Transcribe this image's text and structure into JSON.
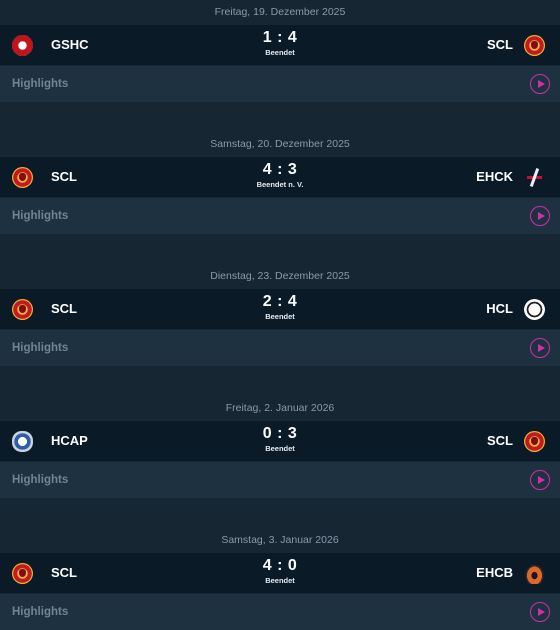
{
  "highlights_label": "Highlights",
  "colors": {
    "background": "#162633",
    "match_row": "#0a1b27",
    "highlights_row": "#1e3141",
    "play_accent": "#d12fa8"
  },
  "games": [
    {
      "date": "Freitag, 19. Dezember 2025",
      "home": "GSHC",
      "home_logo": "gshc-logo-icon",
      "score": "1 : 4",
      "status": "Beendet",
      "away": "SCL",
      "away_logo": "scl-logo-icon"
    },
    {
      "date": "Samstag, 20. Dezember 2025",
      "home": "SCL",
      "home_logo": "scl-logo-icon",
      "score": "4 : 3",
      "status": "Beendet n. V.",
      "away": "EHCK",
      "away_logo": "ehck-logo-icon"
    },
    {
      "date": "Dienstag, 23. Dezember 2025",
      "home": "SCL",
      "home_logo": "scl-logo-icon",
      "score": "2 : 4",
      "status": "Beendet",
      "away": "HCL",
      "away_logo": "hcl-logo-icon"
    },
    {
      "date": "Freitag, 2. Januar 2026",
      "home": "HCAP",
      "home_logo": "hcap-logo-icon",
      "score": "0 : 3",
      "status": "Beendet",
      "away": "SCL",
      "away_logo": "scl-logo-icon"
    },
    {
      "date": "Samstag, 3. Januar 2026",
      "home": "SCL",
      "home_logo": "scl-logo-icon",
      "score": "4 : 0",
      "status": "Beendet",
      "away": "EHCB",
      "away_logo": "ehcb-logo-icon"
    }
  ]
}
